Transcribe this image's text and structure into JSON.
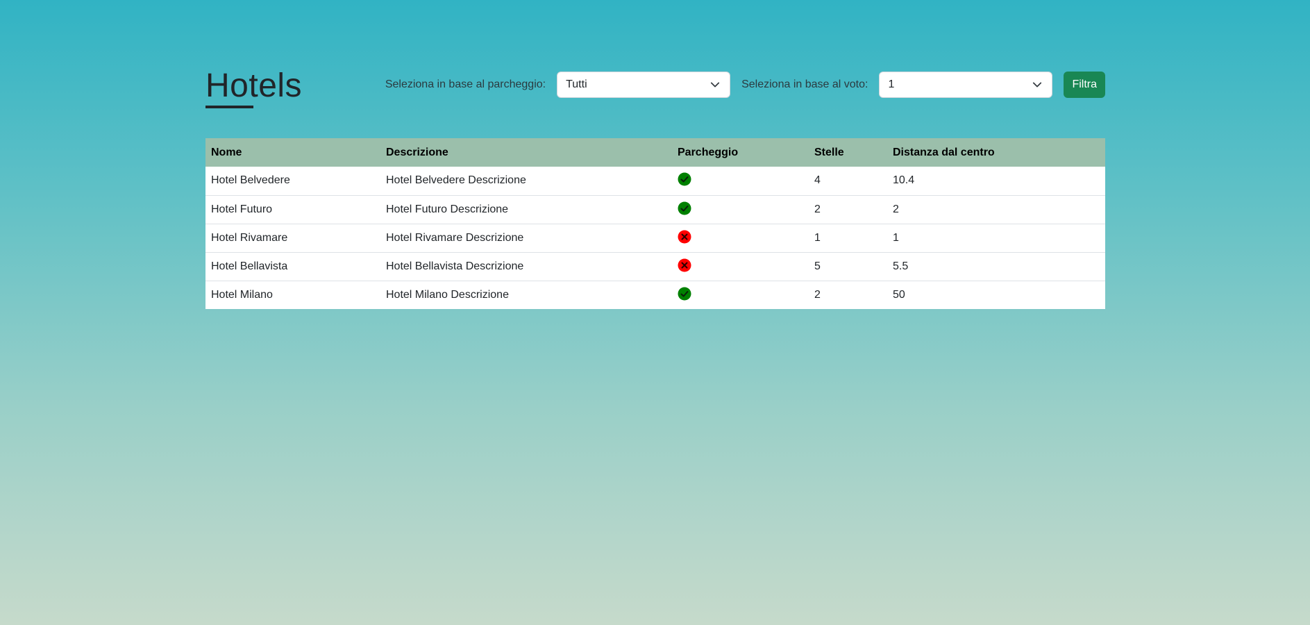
{
  "header": {
    "title": "Hotels"
  },
  "filters": {
    "parking_label": "Seleziona in base al parcheggio:",
    "parking_value": "Tutti",
    "rating_label": "Seleziona in base al voto:",
    "rating_value": "1",
    "submit_label": "Filtra"
  },
  "table": {
    "columns": [
      "Nome",
      "Descrizione",
      "Parcheggio",
      "Stelle",
      "Distanza dal centro"
    ],
    "rows": [
      {
        "nome": "Hotel Belvedere",
        "descrizione": "Hotel Belvedere Descrizione",
        "parcheggio": "check-icon",
        "stelle": "4",
        "distanza": "10.4"
      },
      {
        "nome": "Hotel Futuro",
        "descrizione": "Hotel Futuro Descrizione",
        "parcheggio": "check-icon",
        "stelle": "2",
        "distanza": "2"
      },
      {
        "nome": "Hotel Rivamare",
        "descrizione": "Hotel Rivamare Descrizione",
        "parcheggio": "cross-icon",
        "stelle": "1",
        "distanza": "1"
      },
      {
        "nome": "Hotel Bellavista",
        "descrizione": "Hotel Bellavista Descrizione",
        "parcheggio": "cross-icon",
        "stelle": "5",
        "distanza": "5.5"
      },
      {
        "nome": "Hotel Milano",
        "descrizione": "Hotel Milano Descrizione",
        "parcheggio": "check-icon",
        "stelle": "2",
        "distanza": "50"
      }
    ]
  },
  "colors": {
    "accent": "#198754",
    "table_header": "#9bbfab",
    "check": "#008000",
    "cross": "#ff0000"
  }
}
